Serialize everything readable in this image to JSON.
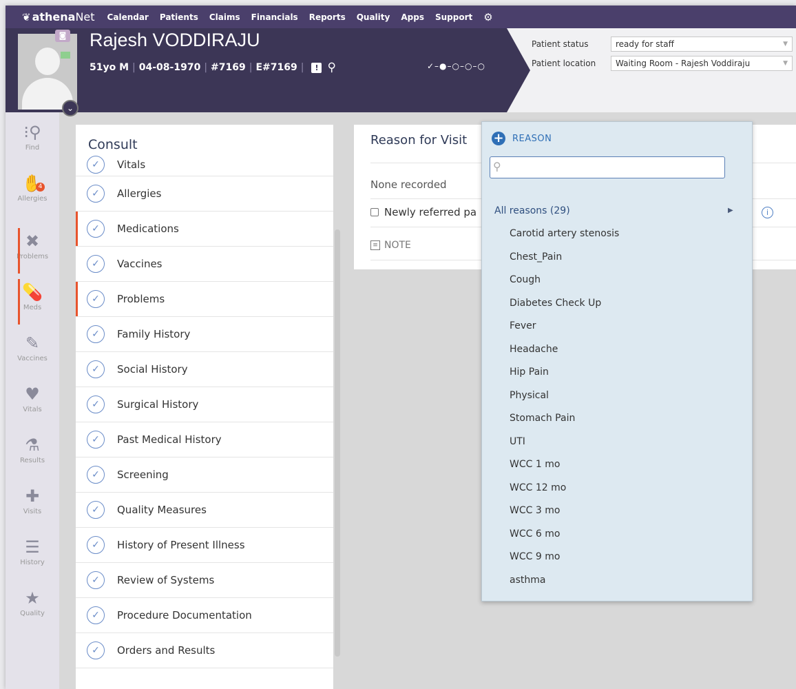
{
  "nav": {
    "logo_bold": "athena",
    "logo_rest": "Net",
    "items": [
      "Calendar",
      "Patients",
      "Claims",
      "Financials",
      "Reports",
      "Quality",
      "Apps",
      "Support"
    ]
  },
  "patient": {
    "name": "Rajesh VODDIRAJU",
    "age_sex": "51yo M",
    "dob": "04-08-1970",
    "id": "#7169",
    "enterprise_id": "E#7169",
    "progress": "✓–●–○–○–○"
  },
  "status": {
    "status_label": "Patient status",
    "status_value": "ready for staff",
    "location_label": "Patient location",
    "location_value": "Waiting Room - Rajesh Voddiraju"
  },
  "rail": {
    "items": [
      {
        "label": "Find",
        "icon": "find-icon"
      },
      {
        "label": "Allergies",
        "icon": "allergies-icon",
        "badge": "4"
      },
      {
        "label": "Problems",
        "icon": "problems-icon"
      },
      {
        "label": "Meds",
        "icon": "meds-icon"
      },
      {
        "label": "Vaccines",
        "icon": "vaccines-icon"
      },
      {
        "label": "Vitals",
        "icon": "vitals-icon"
      },
      {
        "label": "Results",
        "icon": "results-icon"
      },
      {
        "label": "Visits",
        "icon": "visits-icon"
      },
      {
        "label": "History",
        "icon": "history-icon"
      },
      {
        "label": "Quality",
        "icon": "quality-icon"
      }
    ]
  },
  "consult": {
    "title": "Consult",
    "items": [
      "Vitals",
      "Allergies",
      "Medications",
      "Vaccines",
      "Problems",
      "Family History",
      "Social History",
      "Surgical History",
      "Past Medical History",
      "Screening",
      "Quality Measures",
      "History of Present Illness",
      "Review of Systems",
      "Procedure Documentation",
      "Orders and Results"
    ]
  },
  "reason_card": {
    "title": "Reason for Visit",
    "none": "None recorded",
    "checkbox_label": "Newly referred pa",
    "note_label": "NOTE"
  },
  "dropdown": {
    "add_label": "REASON",
    "search_value": "",
    "all_label": "All reasons (29)",
    "items": [
      "Carotid artery stenosis",
      "Chest_Pain",
      "Cough",
      "Diabetes Check Up",
      "Fever",
      "Headache",
      "Hip Pain",
      "Physical",
      "Stomach Pain",
      "UTI",
      "WCC 1 mo",
      "WCC 12 mo",
      "WCC 3 mo",
      "WCC 6 mo",
      "WCC 9 mo",
      "asthma"
    ]
  },
  "colors": {
    "nav_bg": "#4a3f6b",
    "banner_bg": "#3c3656",
    "accent_orange": "#e8542d",
    "link_blue": "#2f6fb6",
    "dropdown_bg": "#dde9f1"
  }
}
